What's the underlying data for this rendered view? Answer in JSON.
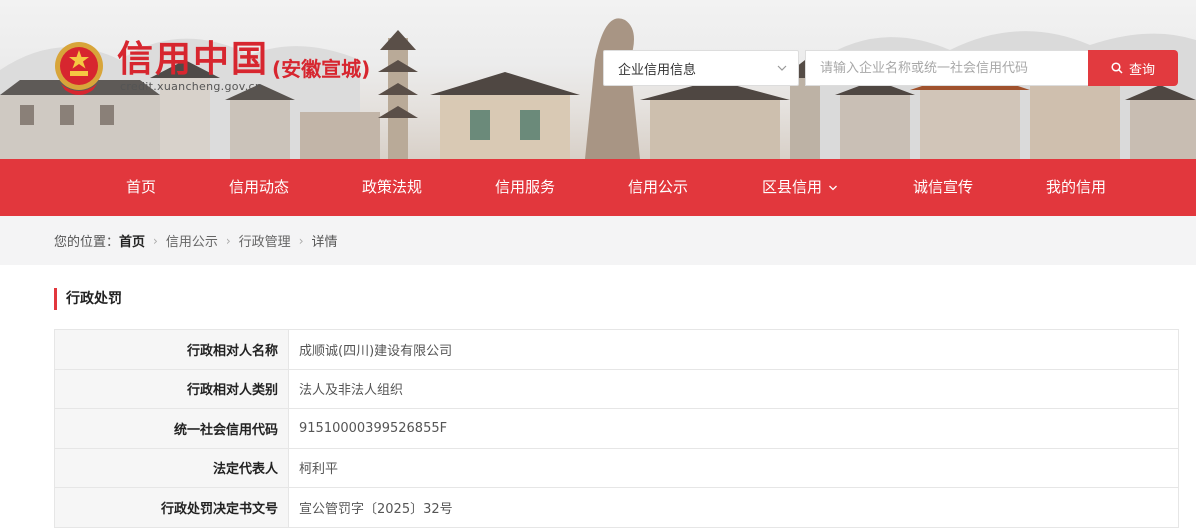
{
  "header": {
    "site_title": "信用中国",
    "site_region": "(安徽宣城)",
    "site_domain": "credit.xuancheng.gov.cn",
    "brand_color": "#d7262f"
  },
  "search": {
    "category_selected": "企业信用信息",
    "placeholder": "请输入企业名称或统一社会信用代码",
    "button_label": "查询"
  },
  "nav": {
    "items": [
      {
        "label": "首页"
      },
      {
        "label": "信用动态"
      },
      {
        "label": "政策法规"
      },
      {
        "label": "信用服务"
      },
      {
        "label": "信用公示"
      },
      {
        "label": "区县信用",
        "has_dropdown": true
      },
      {
        "label": "诚信宣传"
      },
      {
        "label": "我的信用"
      }
    ],
    "background_color": "#e2373d"
  },
  "breadcrumb": {
    "prefix": "您的位置：",
    "items": [
      "首页",
      "信用公示",
      "行政管理",
      "详情"
    ]
  },
  "section": {
    "title": "行政处罚"
  },
  "details": {
    "rows": [
      {
        "key": "行政相对人名称",
        "value": "成顺诚(四川)建设有限公司"
      },
      {
        "key": "行政相对人类别",
        "value": "法人及非法人组织"
      },
      {
        "key": "统一社会信用代码",
        "value": "91510000399526855F"
      },
      {
        "key": "法定代表人",
        "value": "柯利平"
      },
      {
        "key": "行政处罚决定书文号",
        "value": "宣公管罚字〔2025〕32号"
      }
    ]
  }
}
